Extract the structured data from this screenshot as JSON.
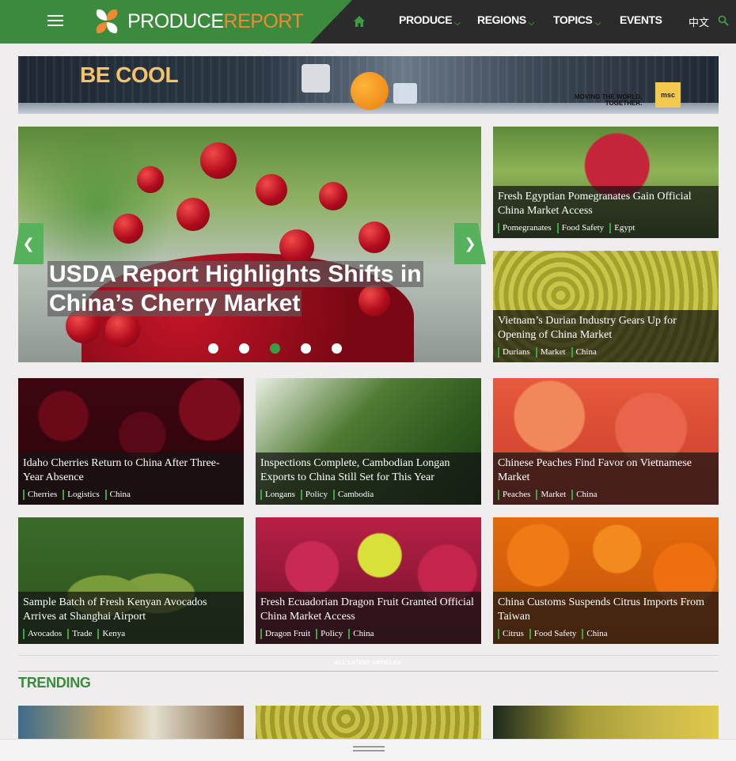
{
  "site": {
    "logo_part1": "PRODUCE",
    "logo_part2": "REPORT",
    "brand_green": "#3b8a3e",
    "brand_orange": "#f08a32"
  },
  "nav": {
    "items": [
      {
        "label": "PRODUCE",
        "has_dropdown": true
      },
      {
        "label": "REGIONS",
        "has_dropdown": true
      },
      {
        "label": "TOPICS",
        "has_dropdown": true
      },
      {
        "label": "EVENTS",
        "has_dropdown": false
      }
    ],
    "language": "中文",
    "icons": [
      "hamburger-menu-icon",
      "home-icon",
      "search-icon"
    ]
  },
  "banner": {
    "headline": "BE COOL",
    "tagline_line1": "MOVING THE WORLD,",
    "tagline_line2": "TOGETHER.",
    "brand": "msc"
  },
  "hero": {
    "title_line1": "USDA Report Highlights Shifts in",
    "title_line2": "China’s Cherry Market",
    "slides_total": 5,
    "active_slide": 3
  },
  "side_stories": [
    {
      "title": "Fresh Egyptian Pomegranates Gain Official China Market Access",
      "tags": [
        "Pomegranates",
        "Food Safety",
        "Egypt"
      ]
    },
    {
      "title": "Vietnam’s Durian Industry Gears Up for Opening of China Market",
      "tags": [
        "Durians",
        "Market",
        "China"
      ]
    }
  ],
  "grid_stories": [
    {
      "title": "Idaho Cherries Return to China After Three-Year Absence",
      "tags": [
        "Cherries",
        "Logistics",
        "China"
      ]
    },
    {
      "title": "Inspections Complete, Cambodian Longan Exports to China Still Set for This Year",
      "tags": [
        "Longans",
        "Policy",
        "Cambodia"
      ]
    },
    {
      "title": "Chinese Peaches Find Favor on Vietnamese Market",
      "tags": [
        "Peaches",
        "Market",
        "China"
      ]
    },
    {
      "title": "Sample Batch of Fresh Kenyan Avocados Arrives at Shanghai Airport",
      "tags": [
        "Avocados",
        "Trade",
        "Kenya"
      ]
    },
    {
      "title": "Fresh Ecuadorian Dragon Fruit Granted Official China Market Access",
      "tags": [
        "Dragon Fruit",
        "Policy",
        "China"
      ]
    },
    {
      "title": "China Customs Suspends Citrus Imports From Taiwan",
      "tags": [
        "Citrus",
        "Food Safety",
        "China"
      ]
    }
  ],
  "latest_link": "ALL LATEST ARTICLES",
  "trending_heading": "TRENDING"
}
